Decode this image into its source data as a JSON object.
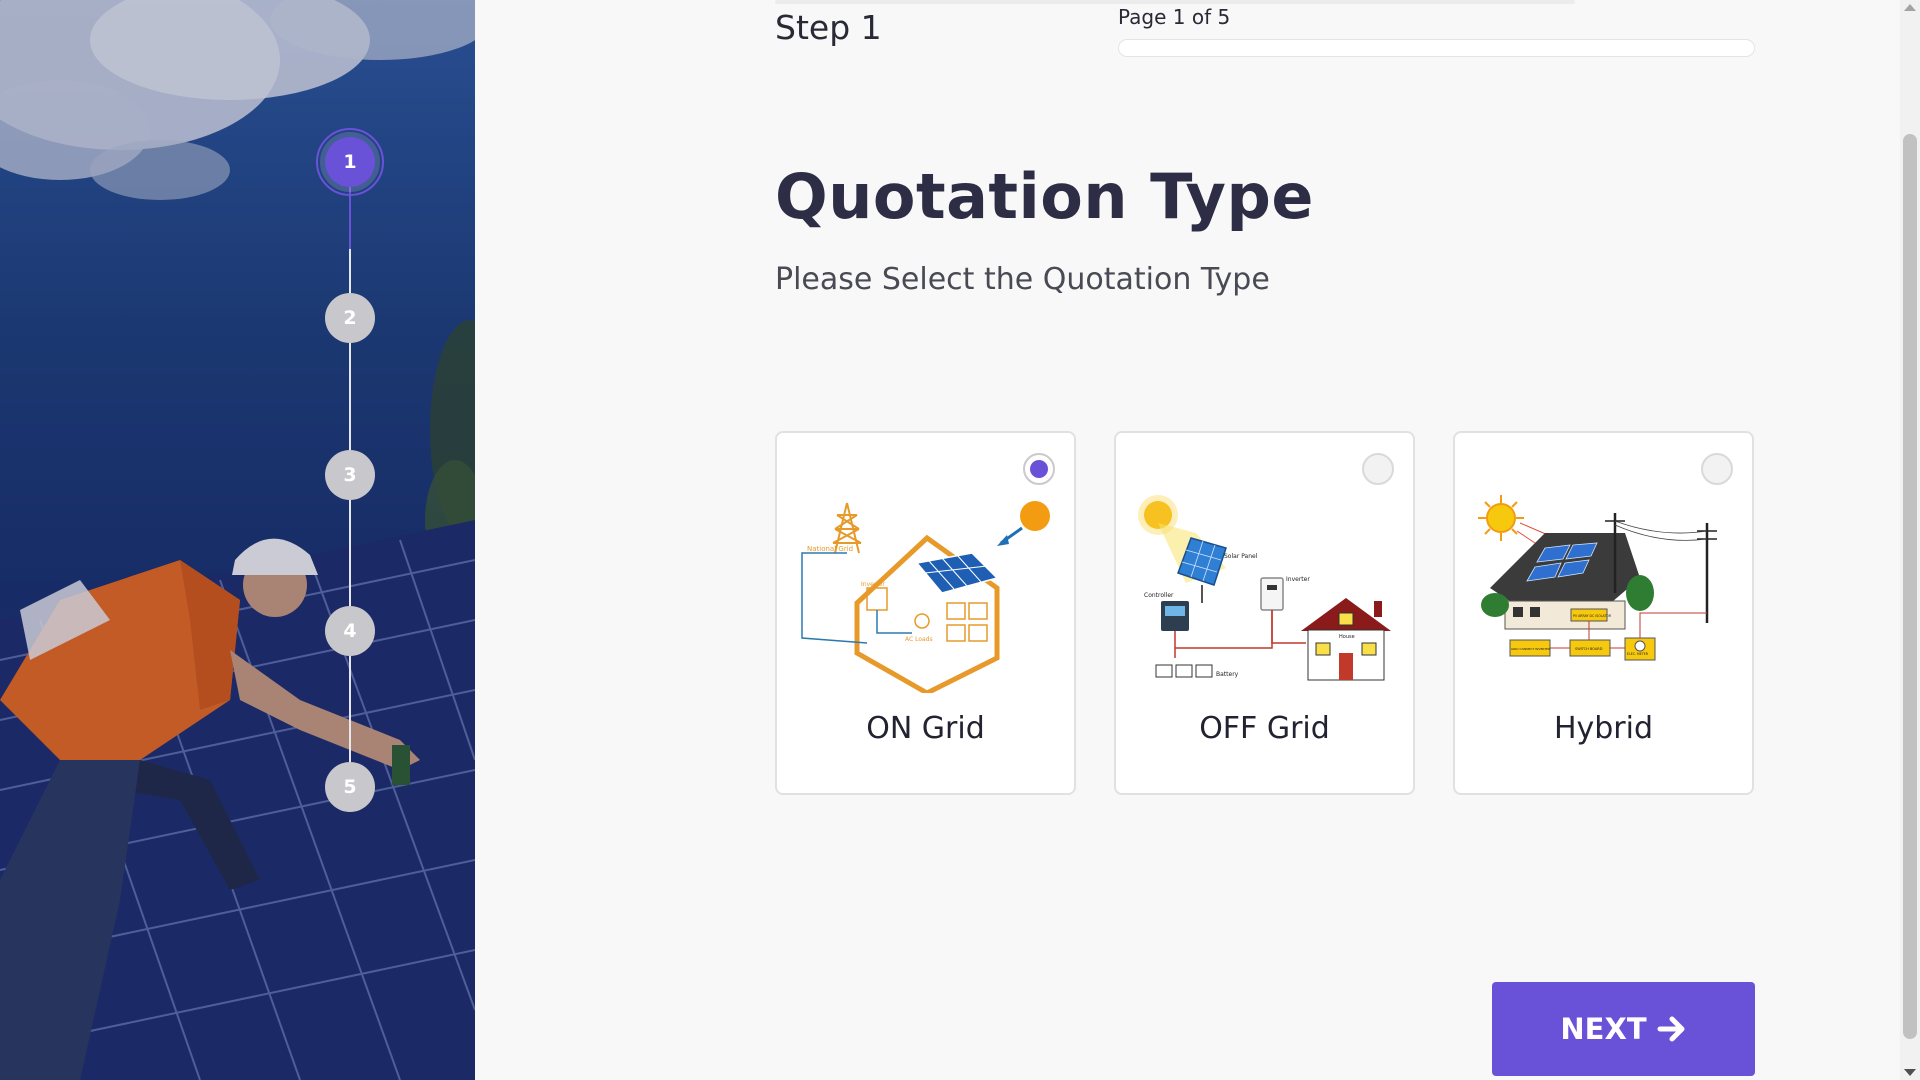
{
  "wizard": {
    "steps": [
      "1",
      "2",
      "3",
      "4",
      "5"
    ],
    "current_step": 1,
    "step_label": "Step 1",
    "page_info": "Page 1 of 5",
    "progress_fraction": 0.0
  },
  "content": {
    "title": "Quotation Type",
    "subtitle": "Please Select the Quotation Type"
  },
  "options": [
    {
      "label": "ON Grid",
      "selected": true,
      "diagram": {
        "grid": "National Grid",
        "inverter": "Inverter",
        "loads": "AC Loads"
      }
    },
    {
      "label": "OFF Grid",
      "selected": false,
      "diagram": {
        "panel": "Solar Panel",
        "inverter": "Inverter",
        "controller": "Controller",
        "battery": "Battery",
        "house": "House"
      }
    },
    {
      "label": "Hybrid",
      "selected": false,
      "diagram": {
        "inverter": "GRID CONNECT INVERTER",
        "dc_box": "PV ARRAY DC ISOLATOR",
        "switchboard": "SWITCH BOARD",
        "meter": "ELEC. METER"
      }
    }
  ],
  "actions": {
    "next_label": "NEXT"
  },
  "colors": {
    "accent": "#6a52d8",
    "title": "#2d2d45",
    "text": "#222230"
  },
  "icons": {
    "next": "arrow-right-icon"
  }
}
